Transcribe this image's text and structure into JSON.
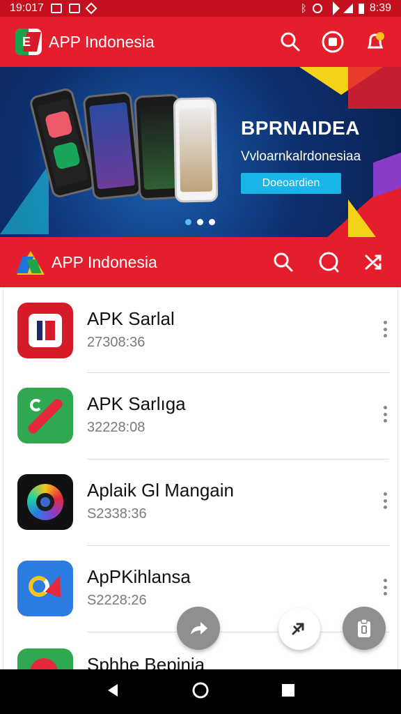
{
  "status_bar": {
    "time_left": "19:017",
    "time_right": "8:39",
    "icons_left": [
      "notification-icon",
      "message-icon",
      "signal-diamond-icon"
    ],
    "icons_right": [
      "bluetooth-icon",
      "alarm-icon",
      "wifi-icon",
      "cellular-icon",
      "battery-icon"
    ]
  },
  "top_bar": {
    "title": "APP Indonesia",
    "actions": [
      "search-icon",
      "stop-icon",
      "notification-bell-icon"
    ]
  },
  "banner": {
    "heading": "BPRNAIDEA",
    "subtitle": "Vvloarnkalrdonesiaa",
    "button_label": "Doeoardien",
    "dots": 3,
    "active_dot": 1
  },
  "second_bar": {
    "title": "APP Indonesia",
    "actions": [
      "search-icon",
      "chat-icon",
      "shuffle-icon"
    ]
  },
  "apps": [
    {
      "name": "APK Sarlal",
      "meta": "27308:36",
      "icon_color": "#d71a28"
    },
    {
      "name": "APK Sarlıga",
      "meta": "32228:08",
      "icon_color": "#2fa84f"
    },
    {
      "name": "Aplaik Gl Mangain",
      "meta": "S2338:36",
      "icon_color": "#111111"
    },
    {
      "name": "ApPKihlansa",
      "meta": "S2228:26",
      "icon_color": "#2b7be0"
    },
    {
      "name": "Sphhe Bepinia",
      "meta": "",
      "icon_color": "#2fa84f"
    }
  ],
  "colors": {
    "primary": "#e51e2d",
    "status_bar": "#c4101e",
    "banner_button": "#19b4e8"
  }
}
